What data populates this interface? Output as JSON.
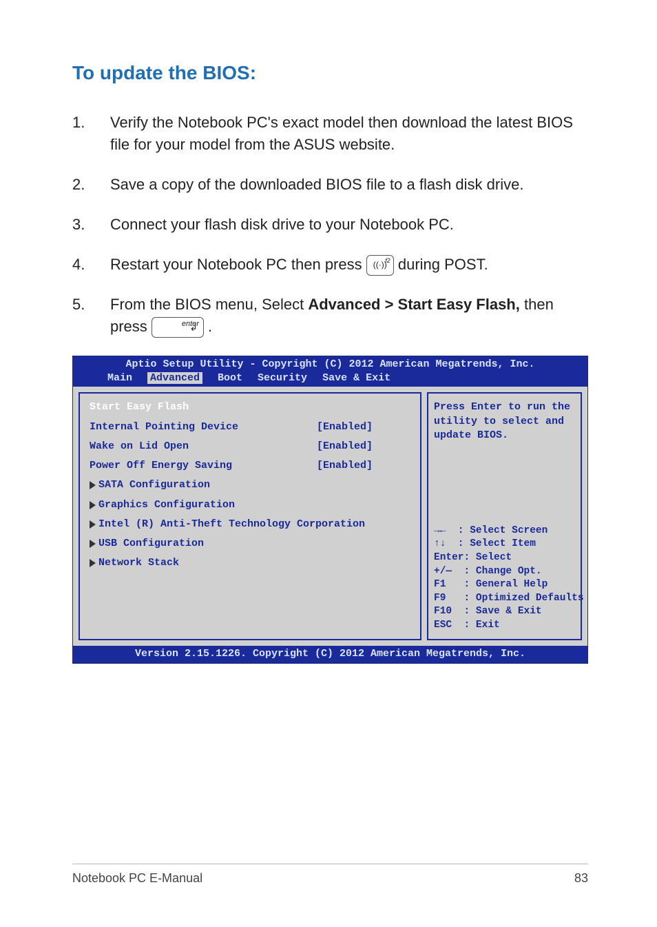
{
  "heading": "To update the BIOS:",
  "steps": {
    "s1": {
      "num": "1.",
      "text": "Verify the Notebook PC's exact model then download the latest BIOS file for your model from the ASUS website."
    },
    "s2": {
      "num": "2.",
      "text": "Save a copy of the downloaded BIOS file to a flash disk drive."
    },
    "s3": {
      "num": "3.",
      "text": "Connect your flash disk drive to your Notebook PC."
    },
    "s4": {
      "num": "4.",
      "pre": "Restart your Notebook PC then press ",
      "post": " during POST."
    },
    "s5": {
      "num": "5.",
      "pre": "From the BIOS menu, Select ",
      "bold": "Advanced > Start Easy Flash,",
      "mid": " then press ",
      "post": "."
    }
  },
  "keys": {
    "f2_sup": "f2",
    "enter_label": "enter"
  },
  "bios": {
    "title": "Aptio Setup Utility - Copyright (C) 2012 American Megatrends, Inc.",
    "tabs": {
      "main": "Main",
      "advanced": "Advanced",
      "boot": "Boot",
      "security": "Security",
      "save": "Save & Exit"
    },
    "left": {
      "easyflash": "Start Easy Flash",
      "ipd_k": "Internal Pointing Device",
      "ipd_v": "[Enabled]",
      "wol_k": "Wake on Lid Open",
      "wol_v": "[Enabled]",
      "pes_k": "Power Off Energy Saving",
      "pes_v": "[Enabled]",
      "sata": "SATA Configuration",
      "gfx": "Graphics Configuration",
      "intel": "Intel (R) Anti-Theft Technology Corporation",
      "usb": "USB Configuration",
      "net": "Network Stack"
    },
    "help_top": "Press Enter to run the utility to select and update BIOS.",
    "help_bottom": {
      "l1": "→←  : Select Screen",
      "l2": "↑↓  : Select Item",
      "l3": "Enter: Select",
      "l4": "+/—  : Change Opt.",
      "l5": "F1   : General Help",
      "l6": "F9   : Optimized Defaults",
      "l7": "F10  : Save & Exit",
      "l8": "ESC  : Exit"
    },
    "footer": "Version 2.15.1226. Copyright (C) 2012 American Megatrends, Inc."
  },
  "page_footer": {
    "left": "Notebook PC E-Manual",
    "right": "83"
  }
}
